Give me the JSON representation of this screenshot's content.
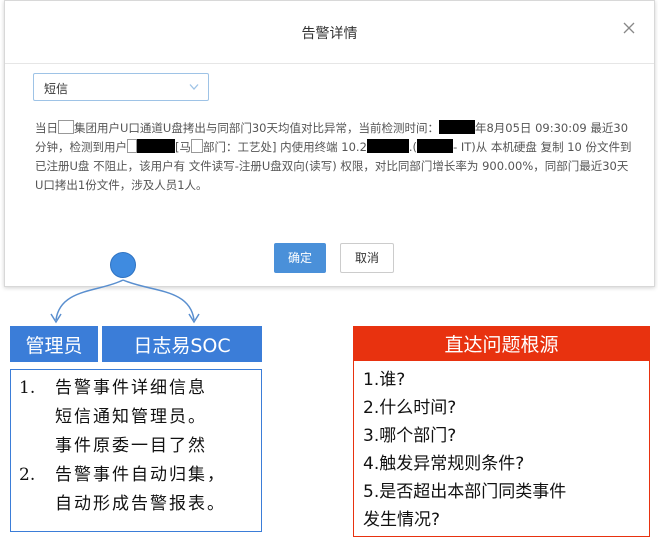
{
  "dialog": {
    "title": "告警详情",
    "select_value": "短信",
    "message": {
      "p1": "当日",
      "p2": "集团用户U口通道U盘拷出与同部门30天均值对比异常，当前检测时间：",
      "p3": "年8月05日 09:30:09 最近30分钟，检测到用户",
      "p4": "[马",
      "p5": "部门：工艺处] 内使用终端 10.2",
      "p6": ".(",
      "p7": "- IT)从 本机硬盘 复制 10 份文件到 已注册U盘 不阻止，该用户有 文件读写-注册U盘双向(读写) 权限，对比同部门增长率为 900.00%，同部门最近30天U口拷出1份文件，涉及人员1人。"
    },
    "confirm_label": "确定",
    "cancel_label": "取消"
  },
  "labels": {
    "admin": "管理员",
    "soc": "日志易SOC",
    "root": "直达问题根源"
  },
  "features": [
    {
      "num": "1.",
      "lines": [
        "告警事件详细信息",
        "短信通知管理员。",
        "事件原委一目了然"
      ]
    },
    {
      "num": "2.",
      "lines": [
        "告警事件自动归集，",
        "自动形成告警报表。"
      ]
    }
  ],
  "questions": [
    "1.谁?",
    "2.什么时间?",
    "3.哪个部门?",
    "4.触发异常规则条件?",
    "5.是否超出本部门同类事件",
    "发生情况?"
  ],
  "colors": {
    "blue": "#3b7dd8",
    "red": "#e8320f",
    "button": "#4a90d9"
  }
}
